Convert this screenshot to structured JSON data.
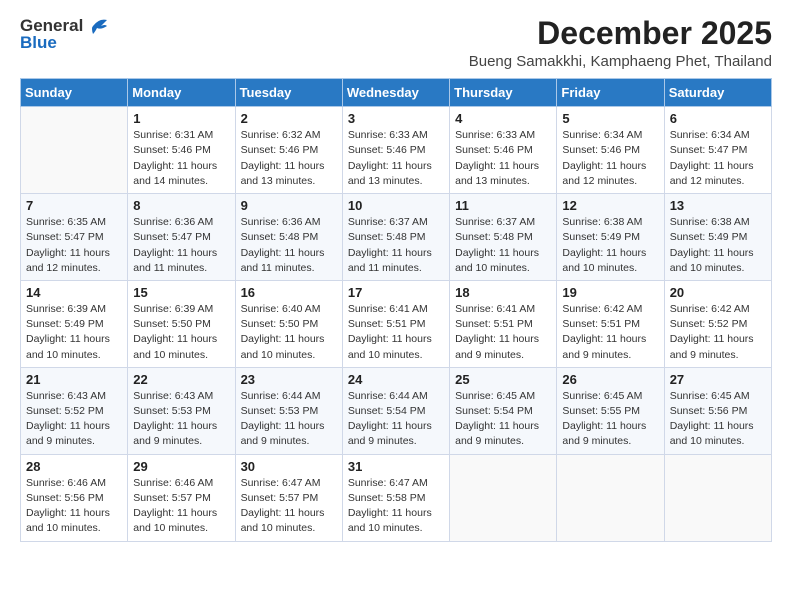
{
  "header": {
    "logo_general": "General",
    "logo_blue": "Blue",
    "title": "December 2025",
    "subtitle": "Bueng Samakkhi, Kamphaeng Phet, Thailand"
  },
  "days_of_week": [
    "Sunday",
    "Monday",
    "Tuesday",
    "Wednesday",
    "Thursday",
    "Friday",
    "Saturday"
  ],
  "weeks": [
    [
      {
        "day": "",
        "info": ""
      },
      {
        "day": "1",
        "info": "Sunrise: 6:31 AM\nSunset: 5:46 PM\nDaylight: 11 hours\nand 14 minutes."
      },
      {
        "day": "2",
        "info": "Sunrise: 6:32 AM\nSunset: 5:46 PM\nDaylight: 11 hours\nand 13 minutes."
      },
      {
        "day": "3",
        "info": "Sunrise: 6:33 AM\nSunset: 5:46 PM\nDaylight: 11 hours\nand 13 minutes."
      },
      {
        "day": "4",
        "info": "Sunrise: 6:33 AM\nSunset: 5:46 PM\nDaylight: 11 hours\nand 13 minutes."
      },
      {
        "day": "5",
        "info": "Sunrise: 6:34 AM\nSunset: 5:46 PM\nDaylight: 11 hours\nand 12 minutes."
      },
      {
        "day": "6",
        "info": "Sunrise: 6:34 AM\nSunset: 5:47 PM\nDaylight: 11 hours\nand 12 minutes."
      }
    ],
    [
      {
        "day": "7",
        "info": "Sunrise: 6:35 AM\nSunset: 5:47 PM\nDaylight: 11 hours\nand 12 minutes."
      },
      {
        "day": "8",
        "info": "Sunrise: 6:36 AM\nSunset: 5:47 PM\nDaylight: 11 hours\nand 11 minutes."
      },
      {
        "day": "9",
        "info": "Sunrise: 6:36 AM\nSunset: 5:48 PM\nDaylight: 11 hours\nand 11 minutes."
      },
      {
        "day": "10",
        "info": "Sunrise: 6:37 AM\nSunset: 5:48 PM\nDaylight: 11 hours\nand 11 minutes."
      },
      {
        "day": "11",
        "info": "Sunrise: 6:37 AM\nSunset: 5:48 PM\nDaylight: 11 hours\nand 10 minutes."
      },
      {
        "day": "12",
        "info": "Sunrise: 6:38 AM\nSunset: 5:49 PM\nDaylight: 11 hours\nand 10 minutes."
      },
      {
        "day": "13",
        "info": "Sunrise: 6:38 AM\nSunset: 5:49 PM\nDaylight: 11 hours\nand 10 minutes."
      }
    ],
    [
      {
        "day": "14",
        "info": "Sunrise: 6:39 AM\nSunset: 5:49 PM\nDaylight: 11 hours\nand 10 minutes."
      },
      {
        "day": "15",
        "info": "Sunrise: 6:39 AM\nSunset: 5:50 PM\nDaylight: 11 hours\nand 10 minutes."
      },
      {
        "day": "16",
        "info": "Sunrise: 6:40 AM\nSunset: 5:50 PM\nDaylight: 11 hours\nand 10 minutes."
      },
      {
        "day": "17",
        "info": "Sunrise: 6:41 AM\nSunset: 5:51 PM\nDaylight: 11 hours\nand 10 minutes."
      },
      {
        "day": "18",
        "info": "Sunrise: 6:41 AM\nSunset: 5:51 PM\nDaylight: 11 hours\nand 9 minutes."
      },
      {
        "day": "19",
        "info": "Sunrise: 6:42 AM\nSunset: 5:51 PM\nDaylight: 11 hours\nand 9 minutes."
      },
      {
        "day": "20",
        "info": "Sunrise: 6:42 AM\nSunset: 5:52 PM\nDaylight: 11 hours\nand 9 minutes."
      }
    ],
    [
      {
        "day": "21",
        "info": "Sunrise: 6:43 AM\nSunset: 5:52 PM\nDaylight: 11 hours\nand 9 minutes."
      },
      {
        "day": "22",
        "info": "Sunrise: 6:43 AM\nSunset: 5:53 PM\nDaylight: 11 hours\nand 9 minutes."
      },
      {
        "day": "23",
        "info": "Sunrise: 6:44 AM\nSunset: 5:53 PM\nDaylight: 11 hours\nand 9 minutes."
      },
      {
        "day": "24",
        "info": "Sunrise: 6:44 AM\nSunset: 5:54 PM\nDaylight: 11 hours\nand 9 minutes."
      },
      {
        "day": "25",
        "info": "Sunrise: 6:45 AM\nSunset: 5:54 PM\nDaylight: 11 hours\nand 9 minutes."
      },
      {
        "day": "26",
        "info": "Sunrise: 6:45 AM\nSunset: 5:55 PM\nDaylight: 11 hours\nand 9 minutes."
      },
      {
        "day": "27",
        "info": "Sunrise: 6:45 AM\nSunset: 5:56 PM\nDaylight: 11 hours\nand 10 minutes."
      }
    ],
    [
      {
        "day": "28",
        "info": "Sunrise: 6:46 AM\nSunset: 5:56 PM\nDaylight: 11 hours\nand 10 minutes."
      },
      {
        "day": "29",
        "info": "Sunrise: 6:46 AM\nSunset: 5:57 PM\nDaylight: 11 hours\nand 10 minutes."
      },
      {
        "day": "30",
        "info": "Sunrise: 6:47 AM\nSunset: 5:57 PM\nDaylight: 11 hours\nand 10 minutes."
      },
      {
        "day": "31",
        "info": "Sunrise: 6:47 AM\nSunset: 5:58 PM\nDaylight: 11 hours\nand 10 minutes."
      },
      {
        "day": "",
        "info": ""
      },
      {
        "day": "",
        "info": ""
      },
      {
        "day": "",
        "info": ""
      }
    ]
  ]
}
